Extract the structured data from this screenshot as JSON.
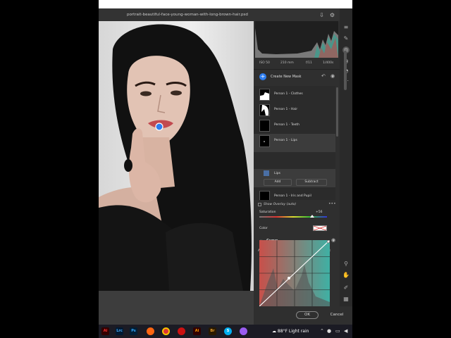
{
  "document": {
    "filename": "portrait-beautiful-face-young-woman-with-long-brown-hair.psd"
  },
  "camera_info": {
    "iso": "ISO 50",
    "focal": "210 mm",
    "aperture": "f/11",
    "shutter": "1/400s"
  },
  "masks": {
    "create_label": "Create New Mask",
    "layers": [
      {
        "label": "Person 1 - Clothes"
      },
      {
        "label": "Person 1 - Hair"
      },
      {
        "label": "Person 1 - Teeth"
      },
      {
        "label": "Person 1 - Lips"
      },
      {
        "label": "Person 1 - Iris and Pupil"
      }
    ],
    "sub_item": "Lips",
    "add_label": "Add",
    "subtract_label": "Subtract"
  },
  "properties": {
    "overlay_label": "Show Overlay (auto)",
    "saturation_label": "Saturation",
    "saturation_value": "+56",
    "saturation_level": 0.78,
    "color_label": "Color",
    "curve_label": "Curve",
    "adjust_label": "Adjust"
  },
  "footer": {
    "ok": "OK",
    "cancel": "Cancel"
  },
  "taskbar": {
    "apps": [
      "Ai",
      "Lrc",
      "Ps",
      "Ai",
      "Br"
    ],
    "weather": "88°F  Light rain"
  },
  "colors": {
    "accent": "#2d7df0",
    "red": "#e03a3a",
    "green": "#3bbf4a",
    "blue": "#3a63e0"
  }
}
